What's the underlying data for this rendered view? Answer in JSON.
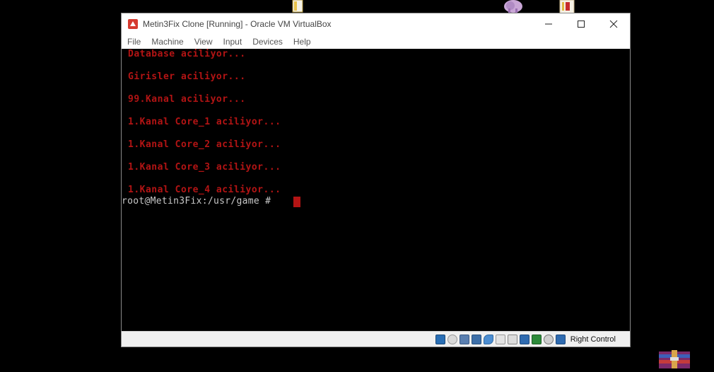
{
  "window": {
    "title": "Metin3Fix Clone [Running] - Oracle VM VirtualBox",
    "controls": {
      "minimize": "—",
      "maximize": "☐",
      "close": "✕"
    }
  },
  "menu": [
    "File",
    "Machine",
    "View",
    "Input",
    "Devices",
    "Help"
  ],
  "console": {
    "lines": [
      "Database aciliyor...",
      "Girisler aciliyor...",
      "99.Kanal aciliyor...",
      "1.Kanal Core_1 aciliyor...",
      "1.Kanal Core_2 aciliyor...",
      "1.Kanal Core_3 aciliyor...",
      "1.Kanal Core_4 aciliyor..."
    ],
    "prompt": "root@Metin3Fix:/usr/game #",
    "text_color": "#b31414",
    "prompt_color": "#c8c8c8"
  },
  "statusbar": {
    "icons": [
      "hard-disk-icon",
      "optical-drive-icon",
      "audio-icon",
      "network-icon",
      "usb-icon",
      "shared-folders-icon",
      "display-icon",
      "recording-icon",
      "cpu-icon",
      "mouse-integration-icon",
      "host-key-icon"
    ],
    "host_key": "Right Control"
  },
  "desktop_icons": [
    "document-icon",
    "elephant-app-icon",
    "pdf-document-icon",
    "winrar-icon"
  ]
}
